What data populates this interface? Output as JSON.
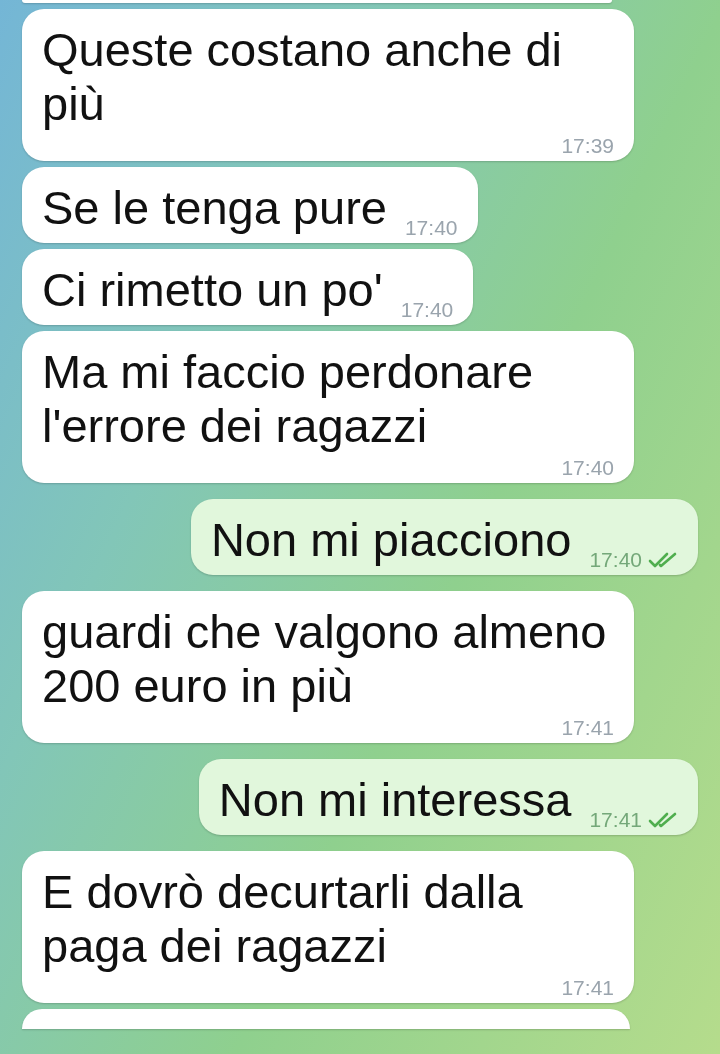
{
  "messages": [
    {
      "kind": "incoming",
      "text": "Queste costano anche di più",
      "time": "17:39"
    },
    {
      "kind": "incoming",
      "text": "Se le tenga pure",
      "time": "17:40"
    },
    {
      "kind": "incoming",
      "text": "Ci rimetto un po'",
      "time": "17:40"
    },
    {
      "kind": "incoming",
      "text": "Ma mi faccio perdonare l'errore dei ragazzi",
      "time": "17:40"
    },
    {
      "kind": "outgoing",
      "text": "Non mi piacciono",
      "time": "17:40",
      "read": true
    },
    {
      "kind": "incoming",
      "text": "guardi che valgono almeno 200 euro in più",
      "time": "17:41"
    },
    {
      "kind": "outgoing",
      "text": "Non mi interessa",
      "time": "17:41",
      "read": true
    },
    {
      "kind": "incoming",
      "text": "E dovrò decurtarli dalla paga dei ragazzi",
      "time": "17:41"
    }
  ]
}
